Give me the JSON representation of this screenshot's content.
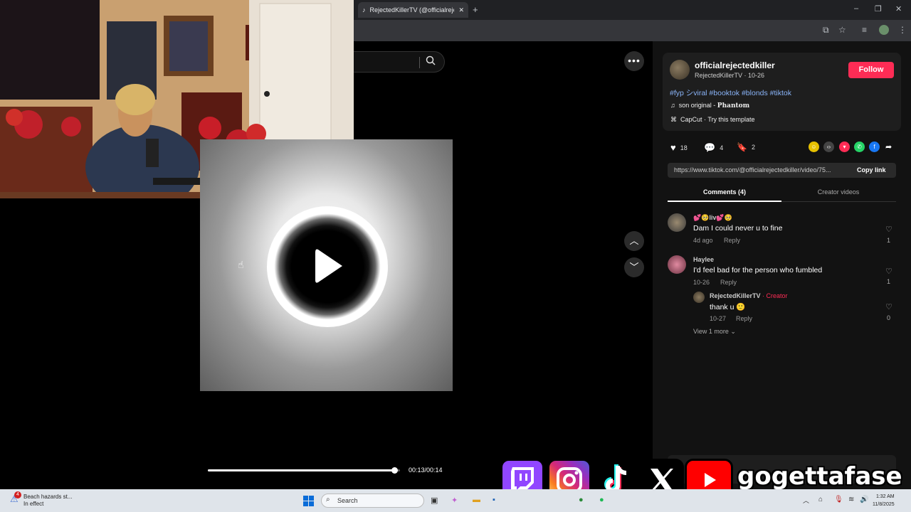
{
  "browser": {
    "tab_title": "RejectedKillerTV (@officialrejec",
    "tab_close": "✕",
    "new_tab": "+",
    "window_controls": [
      "–",
      "❐",
      "✕"
    ]
  },
  "video": {
    "search_icon": "search-icon",
    "more_label": "•••",
    "time": "00:13/00:14",
    "progress_fraction": 0.97
  },
  "post": {
    "username": "officialrejectedkiller",
    "subline": "RejectedKillerTV · 10-26",
    "follow_label": "Follow",
    "hashtags": "#fyp シviral #booktok #blonds #tiktok",
    "sound_label": "son original - ",
    "sound_artist": "Phantom",
    "capcut_label": "CapCut · Try this template",
    "likes": "18",
    "comments_count": "4",
    "saves": "2",
    "link_url": "https://www.tiktok.com/@officialrejectedkiller/video/75...",
    "copy_link": "Copy link",
    "tab_comments": "Comments (4)",
    "tab_creator": "Creator videos"
  },
  "comments": [
    {
      "name": "💕🥺liv💕🥺",
      "text": "Dam I could never u to fine",
      "time": "4d ago",
      "reply": "Reply",
      "likes": "1"
    },
    {
      "name": "Haylee",
      "text": "I'd feel bad for the person who fumbled",
      "time": "10-26",
      "reply": "Reply",
      "likes": "1"
    },
    {
      "name": "RejectedKillerTV",
      "badge": " · Creator",
      "text": "thank u 🙂",
      "time": "10-27",
      "reply": "Reply",
      "likes": "0"
    }
  ],
  "view_more": "View 1 more",
  "overlay": {
    "handle": "gogettafase"
  },
  "taskbar": {
    "weather_line1": "Beach hazards st...",
    "weather_line2": "In effect",
    "weather_badge": "4",
    "search_placeholder": "Search",
    "time": "1:32 AM",
    "date": "11/8/2025"
  },
  "colors": {
    "follow": "#fe2c55",
    "hashtag": "#8ab4f8",
    "creator": "#fe2c55"
  }
}
